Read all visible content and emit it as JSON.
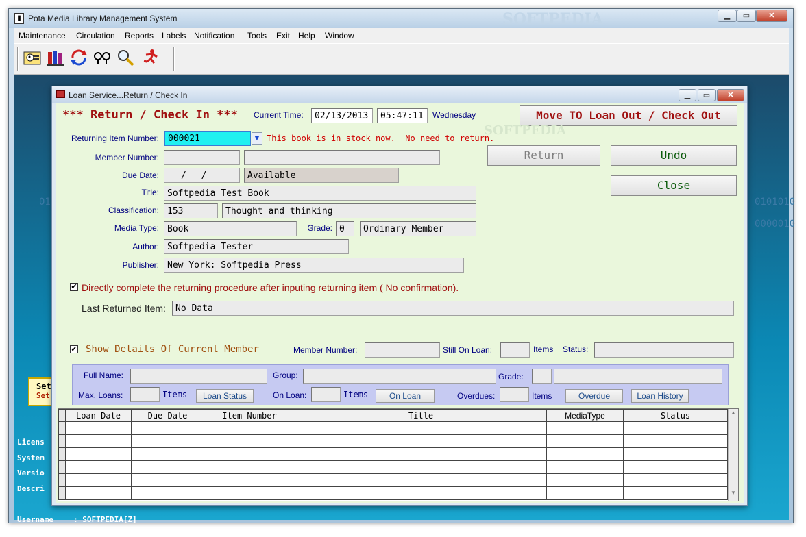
{
  "app": {
    "title": "Pota Media Library Management System",
    "watermark": "SOFTPEDIA",
    "menu": [
      "Maintenance",
      "Circulation",
      "Reports",
      "Labels",
      "Notification",
      "Tools",
      "Exit",
      "Help",
      "Window"
    ]
  },
  "desktop": {
    "bg_left": "01",
    "bg_right1": "0101010",
    "bg_right2": "0000010",
    "settings_line1": "Sett",
    "settings_line2": "Set",
    "side_labels": [
      "Licens",
      "System",
      "Versio",
      "Descri"
    ],
    "username_label": "Username",
    "username_value": ": SOFTPEDIA[Z]"
  },
  "dialog": {
    "title": "Loan Service...Return / Check In",
    "heading": "*** Return / Check In ***",
    "current_time_label": "Current Time:",
    "date": "02/13/2013",
    "time": "05:47:11",
    "weekday": "Wednesday",
    "move_button": "Move TO Loan Out / Check Out",
    "returning_item_label": "Returning Item Number:",
    "returning_item_value": "000021",
    "stock_message": "This book is in stock now.  No need to return.",
    "member_number_label": "Member Number:",
    "due_date_label": "Due Date:",
    "due_date_value": "/ /",
    "status_value": "Available",
    "title_label": "Title:",
    "title_value": "Softpedia Test Book",
    "classification_label": "Classification:",
    "classification_code": "153",
    "classification_name": "Thought and thinking",
    "media_type_label": "Media Type:",
    "media_type_value": "Book",
    "grade_label": "Grade:",
    "grade_value": "0",
    "grade_name": "Ordinary Member",
    "author_label": "Author:",
    "author_value": "Softpedia Tester",
    "publisher_label": "Publisher:",
    "publisher_value": "New York: Softpedia Press",
    "return_button": "Return",
    "undo_button": "Undo",
    "close_button": "Close",
    "direct_complete_label": "Directly complete the returning procedure after inputing returning item ( No confirmation).",
    "last_returned_label": "Last Returned Item:",
    "last_returned_value": "No Data",
    "show_details_label": "Show Details Of Current Member",
    "member_number_label2": "Member Number:",
    "still_on_loan_label": "Still On Loan:",
    "items_label": "Items",
    "status_label": "Status:",
    "full_name_label": "Full Name:",
    "group_label": "Group:",
    "grade_label2": "Grade:",
    "max_loans_label": "Max. Loans:",
    "loan_status_button": "Loan Status",
    "on_loan_label": "On Loan:",
    "on_loan_button": "On Loan",
    "overdues_label": "Overdues:",
    "overdue_button": "Overdue",
    "loan_history_button": "Loan History",
    "table_headers": [
      "Loan Date",
      "Due Date",
      "Item Number",
      "Title",
      "MediaType",
      "Status"
    ]
  }
}
